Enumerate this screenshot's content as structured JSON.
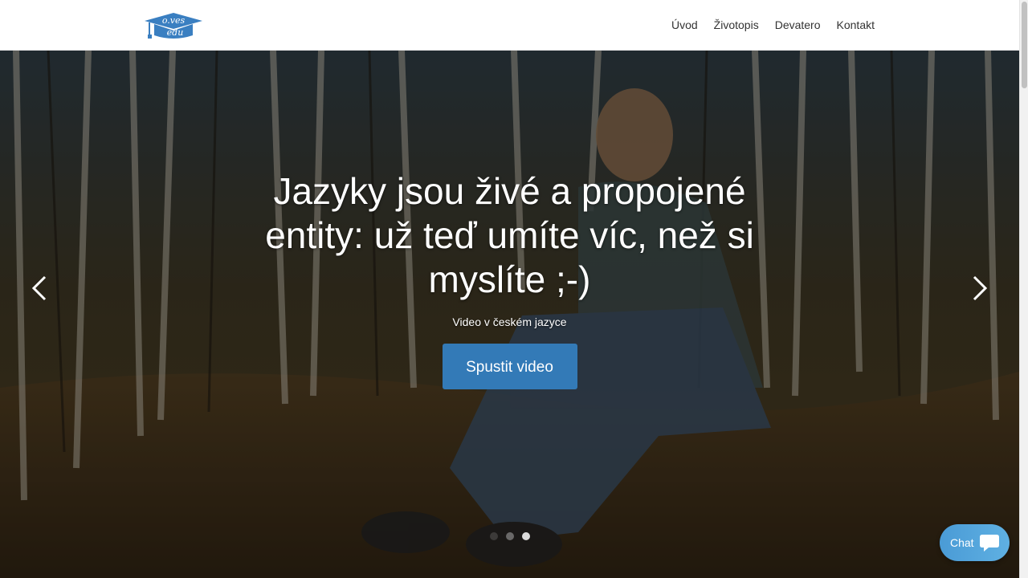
{
  "header": {
    "logo_text_top": "o.ves",
    "logo_text_bottom": "edu",
    "logo_icon": "graduation-cap-icon",
    "nav": [
      {
        "label": "Úvod"
      },
      {
        "label": "Životopis"
      },
      {
        "label": "Devatero"
      },
      {
        "label": "Kontakt"
      }
    ]
  },
  "hero": {
    "title": "Jazyky jsou živé a propojené entity: už teď umíte víc, než si myslíte ;-)",
    "subtitle": "Video v českém jazyce",
    "button_label": "Spustit video",
    "prev_icon": "chevron-left-icon",
    "next_icon": "chevron-right-icon",
    "slide_count": 3,
    "active_slide": 3
  },
  "chat": {
    "label": "Chat",
    "icon": "speech-bubble-icon"
  },
  "colors": {
    "brand_blue": "#337ab7",
    "logo_blue": "#3a7fc1",
    "chat_gradient_start": "#4a9bd6",
    "chat_gradient_end": "#5fb0e2"
  }
}
